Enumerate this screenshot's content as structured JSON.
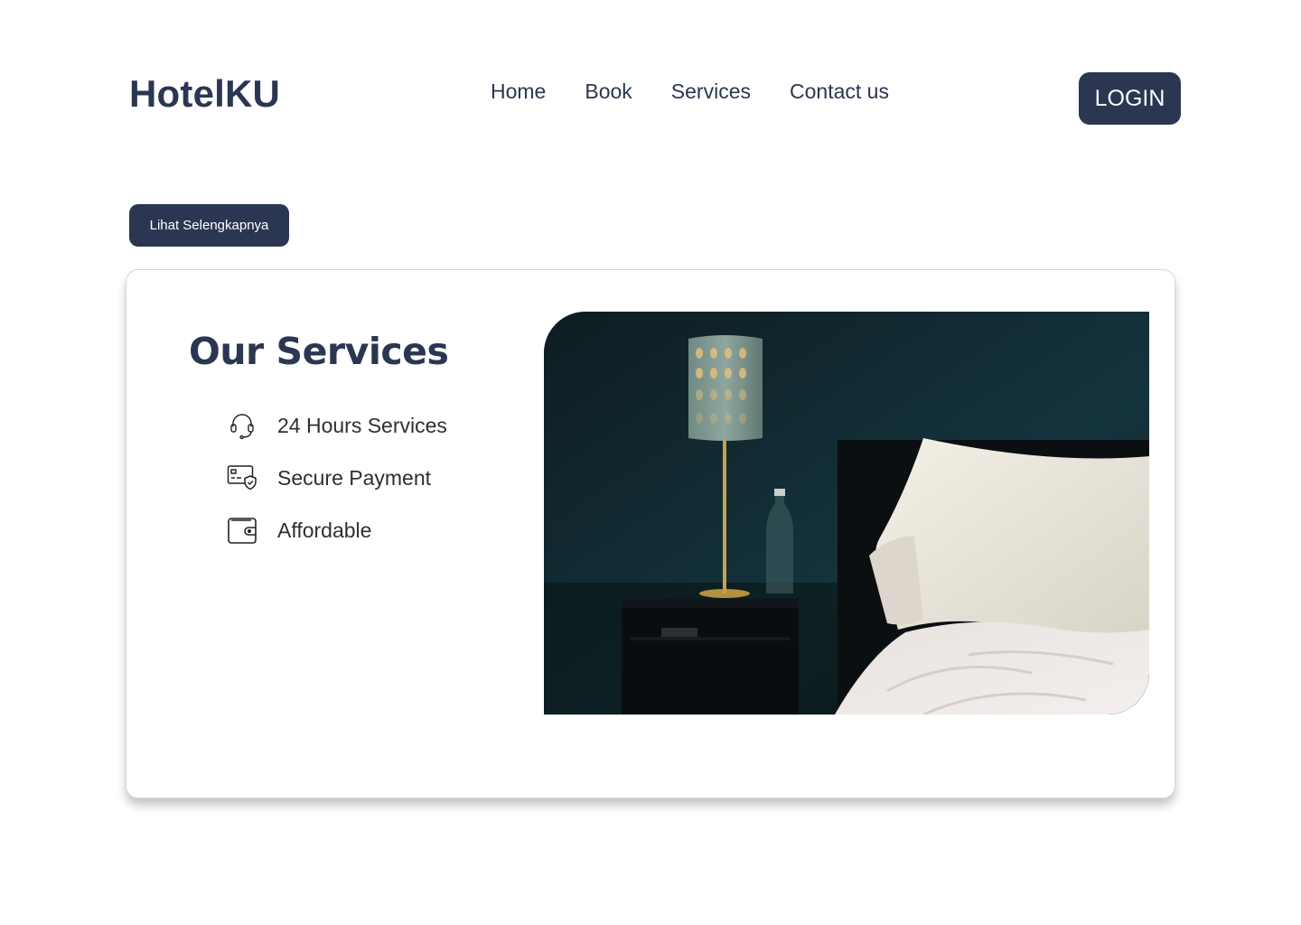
{
  "header": {
    "logo": "HotelKU",
    "nav": [
      "Home",
      "Book",
      "Services",
      "Contact us"
    ],
    "login_label": "LOGIN"
  },
  "cta": {
    "more_label": "Lihat Selengkapnya"
  },
  "services": {
    "title": "Our Services",
    "items": [
      {
        "icon": "headset-icon",
        "label": "24 Hours Services"
      },
      {
        "icon": "card-shield-icon",
        "label": "Secure Payment"
      },
      {
        "icon": "wallet-icon",
        "label": "Affordable"
      }
    ]
  },
  "colors": {
    "primary": "#2b3652",
    "text": "#2f2f2f",
    "card_border": "#d6d6d6"
  }
}
